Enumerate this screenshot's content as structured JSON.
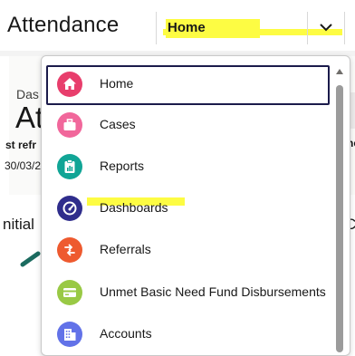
{
  "header": {
    "app_title": "Attendance",
    "nav_selected": "Home"
  },
  "background": {
    "das": "Das",
    "at": "At",
    "st_refr": "st refr",
    "date": "30/03/2",
    "initial": "nitial",
    "right_c": "C",
    "right_s": "ne"
  },
  "menu": {
    "items": [
      {
        "label": "Home",
        "icon": "home-icon",
        "color": "#e83e6c",
        "selected": true
      },
      {
        "label": "Cases",
        "icon": "briefcase-icon",
        "color": "#f1679b"
      },
      {
        "label": "Reports",
        "icon": "clipboard-icon",
        "color": "#11a596"
      },
      {
        "label": "Dashboards",
        "icon": "gauge-icon",
        "color": "#2f2d8c"
      },
      {
        "label": "Referrals",
        "icon": "referral-arrows-icon",
        "color": "#ee5a2f"
      },
      {
        "label": "Unmet Basic Need Fund Disbursements",
        "icon": "card-icon",
        "color": "#99c945"
      },
      {
        "label": "Accounts",
        "icon": "building-icon",
        "color": "#6272e8"
      }
    ]
  },
  "colors": {
    "highlight": "#fdfc43",
    "selected_border": "#1b1b4b"
  }
}
